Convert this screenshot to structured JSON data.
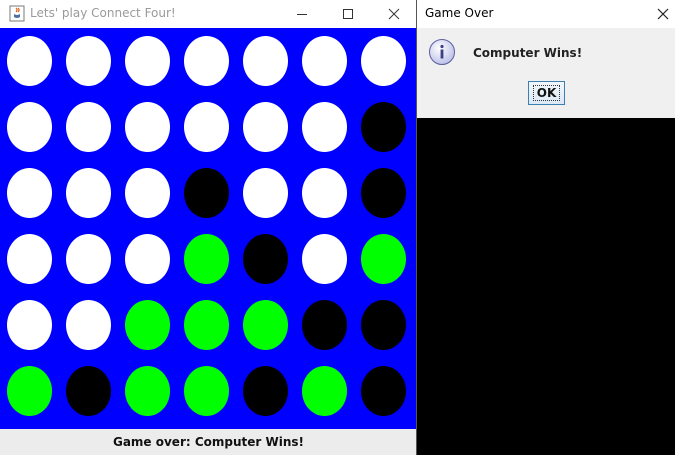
{
  "game_window": {
    "title": "Lets' play Connect Four!",
    "status": "Game over: Computer Wins!"
  },
  "board": {
    "columns": 7,
    "rows": 6,
    "colors": {
      "empty": "#ffffff",
      "computer": "#000000",
      "player": "#00ff00",
      "background": "#0000ff"
    },
    "cells": [
      [
        "empty",
        "empty",
        "empty",
        "empty",
        "empty",
        "empty",
        "empty"
      ],
      [
        "empty",
        "empty",
        "empty",
        "empty",
        "empty",
        "empty",
        "computer"
      ],
      [
        "empty",
        "empty",
        "empty",
        "computer",
        "empty",
        "empty",
        "computer"
      ],
      [
        "empty",
        "empty",
        "empty",
        "player",
        "computer",
        "empty",
        "player"
      ],
      [
        "empty",
        "empty",
        "player",
        "player",
        "player",
        "computer",
        "computer"
      ],
      [
        "player",
        "computer",
        "player",
        "player",
        "computer",
        "player",
        "computer"
      ]
    ]
  },
  "dialog": {
    "title": "Game Over",
    "message": "Computer Wins!",
    "ok_label": "OK"
  }
}
